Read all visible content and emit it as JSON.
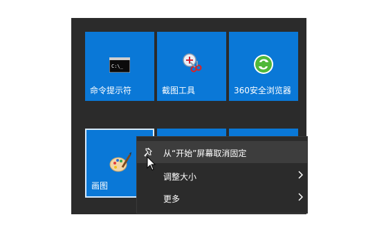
{
  "tiles": [
    {
      "label": "命令提示符",
      "icon": "command-prompt-icon"
    },
    {
      "label": "截图工具",
      "icon": "snipping-tool-icon"
    },
    {
      "label": "360安全浏览器",
      "icon": "360-browser-icon"
    },
    {
      "label": "画图",
      "icon": "paint-icon"
    }
  ],
  "cmd_icon_text": "C:\\_",
  "context_menu": {
    "items": [
      {
        "label": "从“开始”屏幕取消固定",
        "icon": "unpin-icon"
      },
      {
        "label": "调整大小",
        "icon": "chevron-right-icon"
      },
      {
        "label": "更多",
        "icon": "chevron-right-icon"
      }
    ]
  },
  "colors": {
    "tile_blue": "#0a78d7",
    "panel_bg": "#2b2b2b",
    "menu_hover": "#3d3d3d"
  }
}
